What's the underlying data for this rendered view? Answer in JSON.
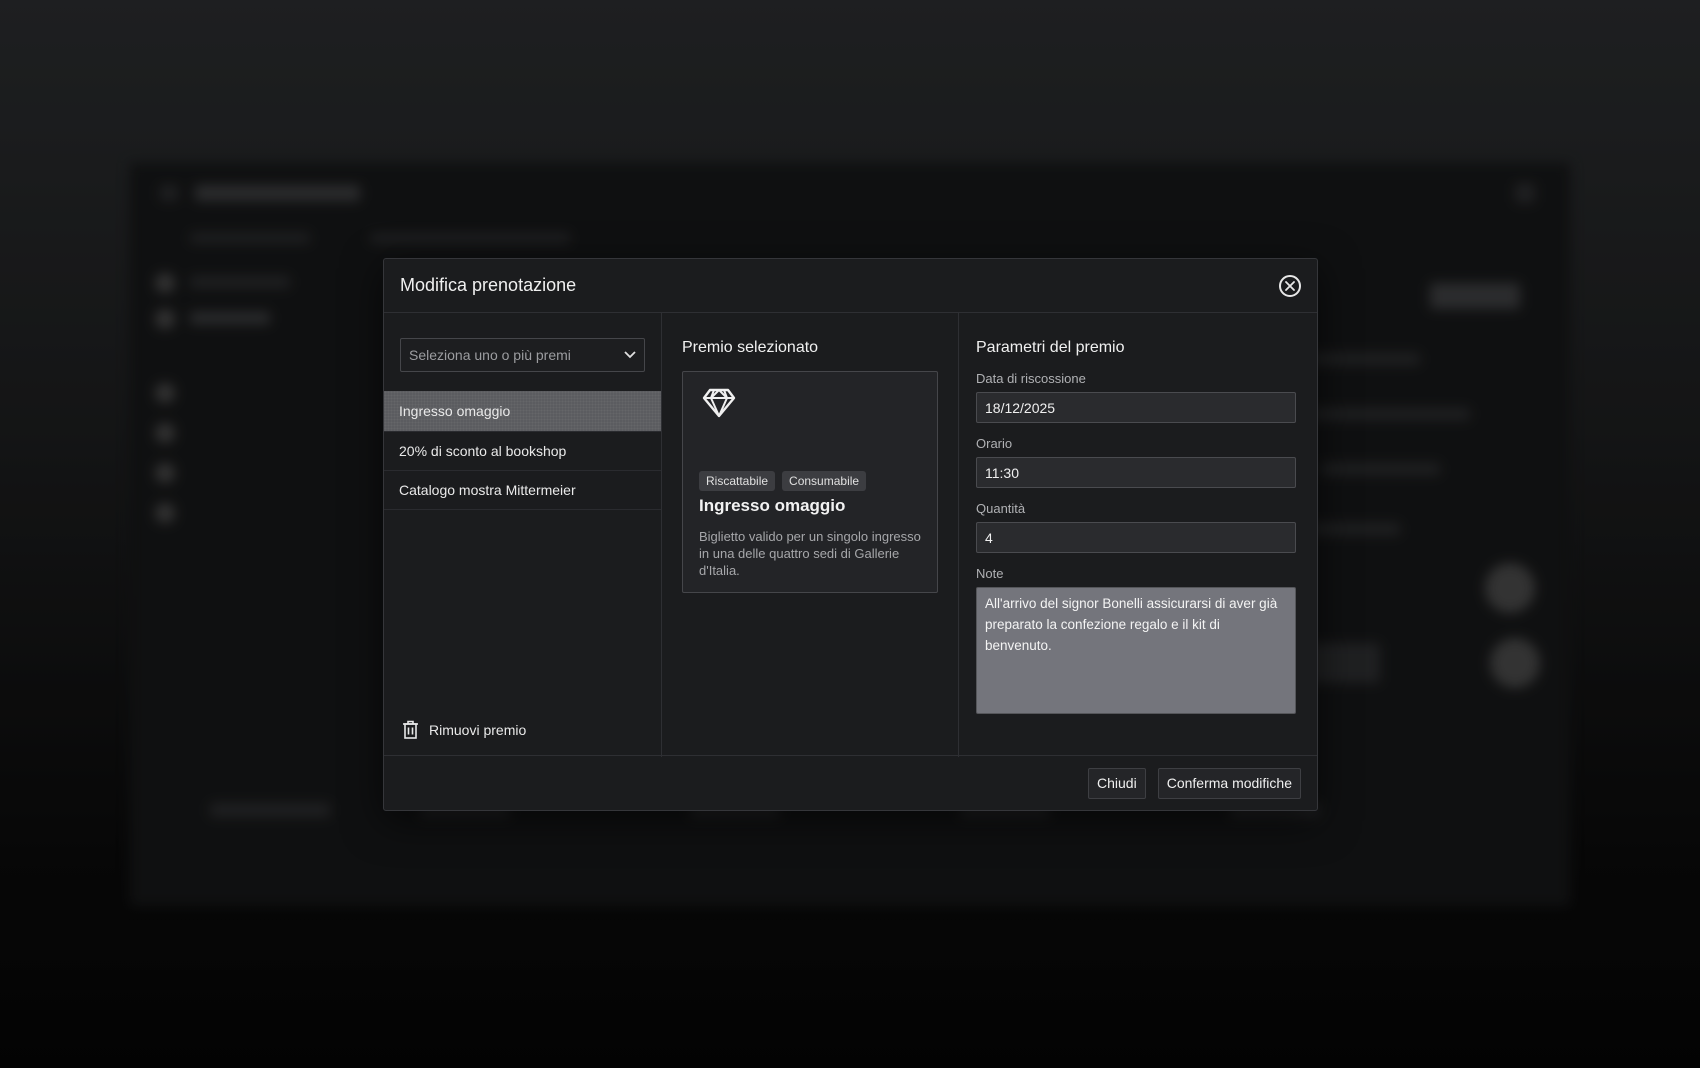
{
  "modal": {
    "title": "Modifica prenotazione"
  },
  "left": {
    "select_placeholder": "Seleziona uno o più premi",
    "prizes": [
      {
        "label": "Ingresso omaggio",
        "active": true
      },
      {
        "label": "20% di sconto al bookshop",
        "active": false
      },
      {
        "label": "Catalogo mostra Mittermeier",
        "active": false
      }
    ],
    "remove_label": "Rimuovi premio"
  },
  "middle": {
    "title": "Premio selezionato",
    "card": {
      "icon": "diamond-icon",
      "tags": [
        "Riscattabile",
        "Consumabile"
      ],
      "name": "Ingresso omaggio",
      "description": "Biglietto valido per un singolo ingresso in una delle quattro sedi di Gallerie d'Italia."
    }
  },
  "right": {
    "title": "Parametri del premio",
    "date": {
      "label": "Data di riscossione",
      "value": "18/12/2025"
    },
    "time": {
      "label": "Orario",
      "value": "11:30"
    },
    "quantity": {
      "label": "Quantità",
      "value": "4"
    },
    "notes": {
      "label": "Note",
      "value": "All'arrivo del signor Bonelli assicurarsi di aver già preparato la confezione regalo e il kit di benvenuto."
    }
  },
  "footer": {
    "close_label": "Chiudi",
    "confirm_label": "Conferma modifiche"
  },
  "colors": {
    "modal_bg": "#1b1c1e",
    "active_item": "#5b5c60",
    "notes_bg": "#74757c"
  }
}
